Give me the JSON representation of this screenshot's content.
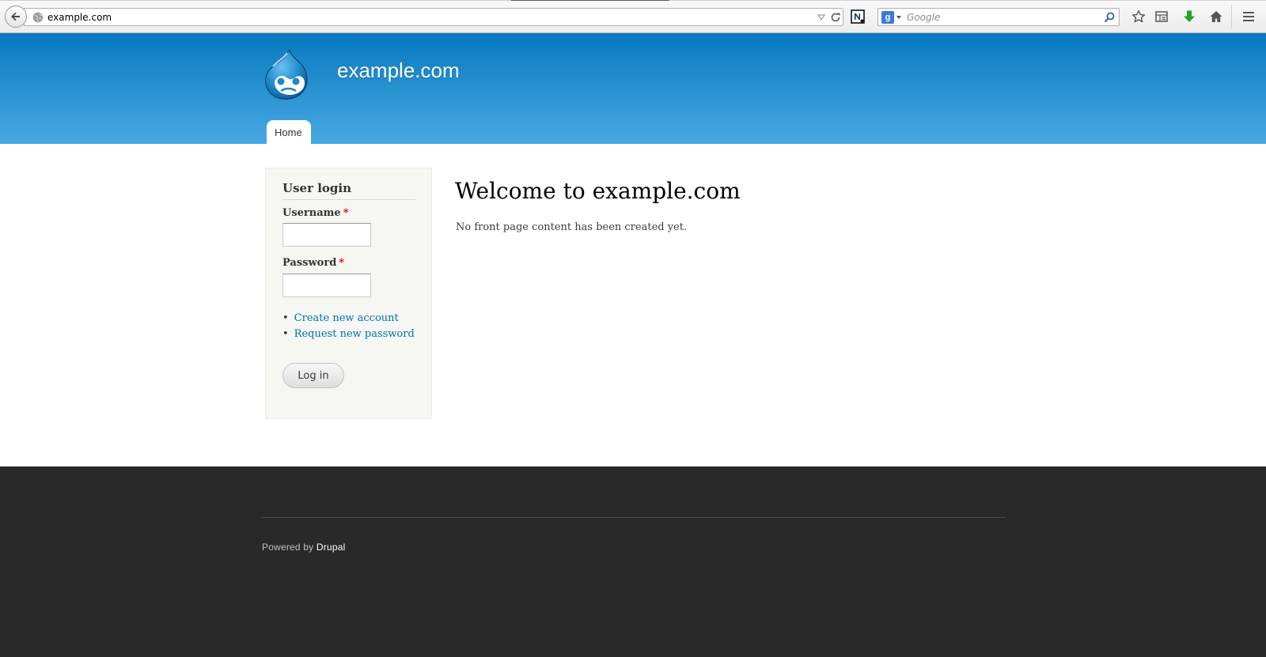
{
  "browser": {
    "url": "example.com",
    "search_placeholder": "Google",
    "search_engine_letter": "g",
    "icons": [
      "back-arrow-icon",
      "globe-icon",
      "dropdown-icon",
      "reload-icon",
      "evernote-icon",
      "google-icon",
      "search-icon",
      "star-icon",
      "reading-list-icon",
      "download-icon",
      "home-icon",
      "hamburger-menu-icon"
    ],
    "colors": {
      "download": "#1fa51f",
      "toolbar": "#ececec"
    }
  },
  "header": {
    "site_name": "example.com",
    "logo": "drupal-drop-logo",
    "menu": [
      {
        "label": "Home"
      }
    ],
    "colors": {
      "top": "#0779bf",
      "bottom": "#48a9e2"
    }
  },
  "sidebar": {
    "title": "User login",
    "username_label": "Username",
    "password_label": "Password",
    "required_marker": "*",
    "username_value": "",
    "password_value": "",
    "links": [
      {
        "label": "Create new account"
      },
      {
        "label": "Request new password"
      }
    ],
    "login_label": "Log in"
  },
  "main": {
    "title": "Welcome to example.com",
    "body": "No front page content has been created yet."
  },
  "footer": {
    "powered_prefix": "Powered by",
    "powered_link": "Drupal"
  }
}
